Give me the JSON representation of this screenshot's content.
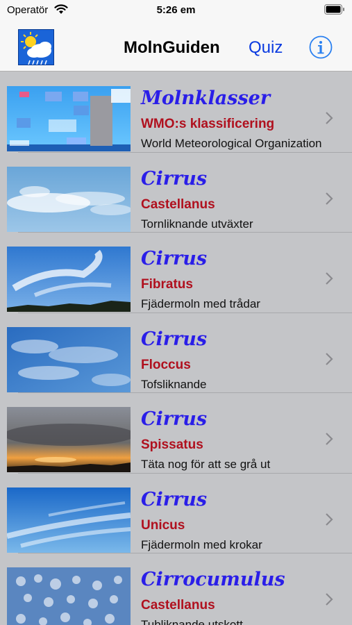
{
  "status_bar": {
    "carrier": "Operatör",
    "time": "5:26 em"
  },
  "nav": {
    "title": "MolnGuiden",
    "quiz_label": "Quiz",
    "info_icon": "info-icon",
    "logo_icon": "sun-cloud-rain-logo"
  },
  "colors": {
    "title": "#2a1ee8",
    "subtitle": "#b0101e",
    "link": "#0a3ae0",
    "background": "#c4c5c8"
  },
  "rows": [
    {
      "title": "Molnklasser",
      "subtitle": "WMO:s klassificering",
      "description": "World Meteorological Organization",
      "thumb": "cloud-classification-chart"
    },
    {
      "title": "Cirrus",
      "subtitle": "Castellanus",
      "description": "Tornliknande utväxter",
      "thumb": "cirrus-castellanus-photo"
    },
    {
      "title": "Cirrus",
      "subtitle": "Fibratus",
      "description": "Fjädermoln med trådar",
      "thumb": "cirrus-fibratus-photo"
    },
    {
      "title": "Cirrus",
      "subtitle": "Floccus",
      "description": "Tofsliknande",
      "thumb": "cirrus-floccus-photo"
    },
    {
      "title": "Cirrus",
      "subtitle": "Spissatus",
      "description": "Täta nog för att se grå ut",
      "thumb": "cirrus-spissatus-photo"
    },
    {
      "title": "Cirrus",
      "subtitle": "Unicus",
      "description": "Fjädermoln med krokar",
      "thumb": "cirrus-unicus-photo"
    },
    {
      "title": "Cirrocumulus",
      "subtitle": "Castellanus",
      "description": "Tubliknande utskott",
      "thumb": "cirrocumulus-castellanus-photo"
    }
  ]
}
